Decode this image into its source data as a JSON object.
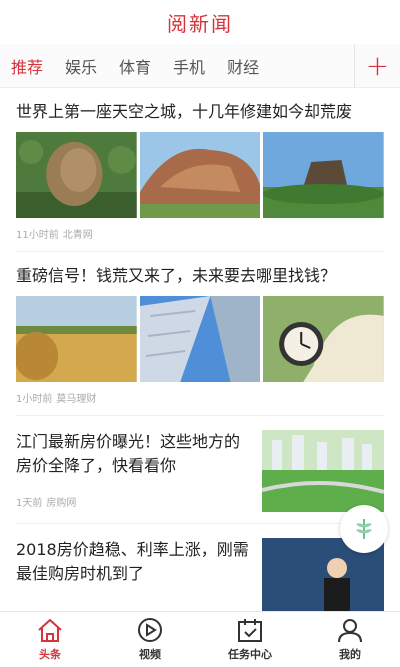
{
  "header": {
    "title": "阅新闻"
  },
  "tabs": [
    {
      "label": "推荐",
      "active": true
    },
    {
      "label": "娱乐",
      "active": false
    },
    {
      "label": "体育",
      "active": false
    },
    {
      "label": "手机",
      "active": false
    },
    {
      "label": "财经",
      "active": false
    }
  ],
  "tabs_more_icon": "plus-icon",
  "articles": [
    {
      "title": "世界上第一座天空之城，十几年修建如今却荒废",
      "time": "11小时前",
      "source": "北青网"
    },
    {
      "title": "重磅信号！钱荒又来了，未来要去哪里找钱？",
      "time": "1小时前",
      "source": "莫马理财"
    },
    {
      "title": "江门最新房价曝光！这些地方的房价全降了，快看看你",
      "time": "1天前",
      "source": "房购网"
    },
    {
      "title": "2018房价趋稳、利率上涨，刚需最佳购房时机到了",
      "time": "",
      "source": ""
    }
  ],
  "tabbar": [
    {
      "label": "头条",
      "icon": "home-icon",
      "active": true
    },
    {
      "label": "视频",
      "icon": "play-icon",
      "active": false
    },
    {
      "label": "任务中心",
      "icon": "calendar-check-icon",
      "active": false
    },
    {
      "label": "我的",
      "icon": "user-icon",
      "active": false
    }
  ],
  "colors": {
    "accent": "#d6343c",
    "text": "#222222",
    "meta": "#aaaaaa"
  }
}
